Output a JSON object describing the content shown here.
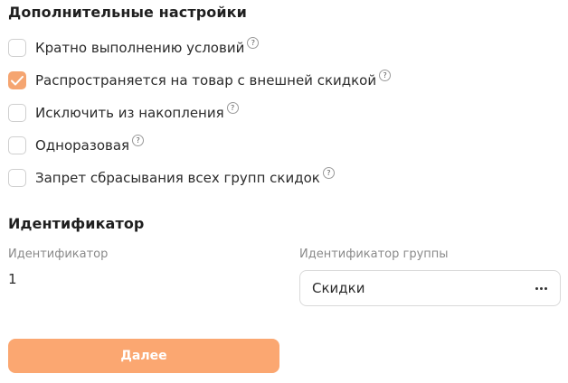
{
  "settings": {
    "title": "Дополнительные настройки",
    "options": [
      {
        "label": "Кратно выполнению условий",
        "checked": false,
        "help": "?"
      },
      {
        "label": "Распространяется на товар с внешней скидкой",
        "checked": true,
        "help": "?"
      },
      {
        "label": "Исключить из накопления",
        "checked": false,
        "help": "?"
      },
      {
        "label": "Одноразовая",
        "checked": false,
        "help": "?"
      },
      {
        "label": "Запрет сбрасывания всех групп скидок",
        "checked": false,
        "help": "?"
      }
    ]
  },
  "identifier": {
    "title": "Идентификатор",
    "id_label": "Идентификатор",
    "id_value": "1",
    "group_label": "Идентификатор группы",
    "group_value": "Скидки"
  },
  "actions": {
    "next_label": "Далее"
  },
  "colors": {
    "accent": "#f5a571",
    "button": "#fba771"
  }
}
